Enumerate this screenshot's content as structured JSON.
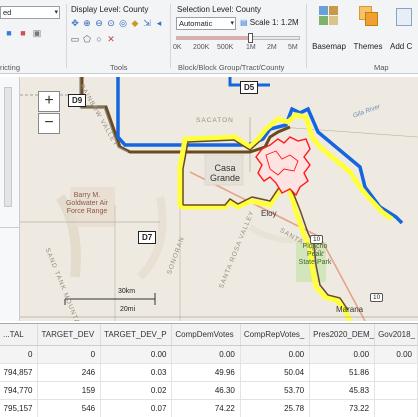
{
  "ribbon": {
    "left_partial_label": "ed",
    "group_districting": "ricting",
    "display_level_label": "Display Level: County",
    "tools_label": "Tools",
    "selection_level_label": "Selection Level: County",
    "selection_value": "Automatic",
    "scale_label": "Scale 1: 1.2M",
    "scale_ticks": [
      "0K",
      "200K",
      "500K",
      "1M",
      "2M",
      "5M"
    ],
    "block_group_label": "Block/Block Group/Tract/County",
    "basemap_label": "Basemap",
    "themes_label": "Themes",
    "add_label": "Add C",
    "map_group_label": "Map"
  },
  "map": {
    "zoom_in": "+",
    "zoom_out": "−",
    "districts": [
      "D9",
      "D5",
      "D7"
    ],
    "places": [
      "Casa Grande",
      "Eloy",
      "Barry M. Goldwater Air Force Range",
      "Picacho Peak State Park",
      "Marana"
    ],
    "labels": {
      "casa": "Casa",
      "grande": "Grande",
      "eloy": "Eloy",
      "barry1": "Barry M.",
      "barry2": "Goldwater Air",
      "barry3": "Force Range",
      "picacho1": "Picacho",
      "picacho2": "Peak",
      "picacho3": "State Park",
      "marana": "Marana",
      "mountains": "SAND TANK MOUNTAINS",
      "santa_cruz": "SANTA CRUZ",
      "valley_top": "RAINBOW VALLEY",
      "sacaton": "SACATON",
      "gila_river": "Gila River",
      "sonoran": "SONORAN",
      "sn_valley": "SANTA ROSA VALLEY"
    },
    "scalebar": {
      "km": "30km",
      "mi": "20mi"
    },
    "route_shields": [
      "10",
      "10"
    ]
  },
  "table": {
    "columns": [
      "...TAL",
      "TARGET_DEV",
      "TARGET_DEV_P",
      "CompDemVotes",
      "CompRepVotes_",
      "Pres2020_DEM_",
      "Gov2018_"
    ],
    "rows": [
      [
        "0",
        "0",
        "0.00",
        "0.00",
        "0.00",
        "0.00",
        "0.00"
      ],
      [
        "794,857",
        "246",
        "0.03",
        "49.96",
        "50.04",
        "51.86",
        ""
      ],
      [
        "794,770",
        "159",
        "0.02",
        "46.30",
        "53.70",
        "45.83",
        ""
      ],
      [
        "795,157",
        "546",
        "0.07",
        "74.22",
        "25.78",
        "73.22",
        ""
      ]
    ]
  },
  "colors": {
    "district_blue": "#1565e0",
    "district_yellow": "#ffff3c",
    "district_brown": "#6b4a1e",
    "selected_red": "#ff1a1a",
    "map_bg": "#eeeae2"
  }
}
